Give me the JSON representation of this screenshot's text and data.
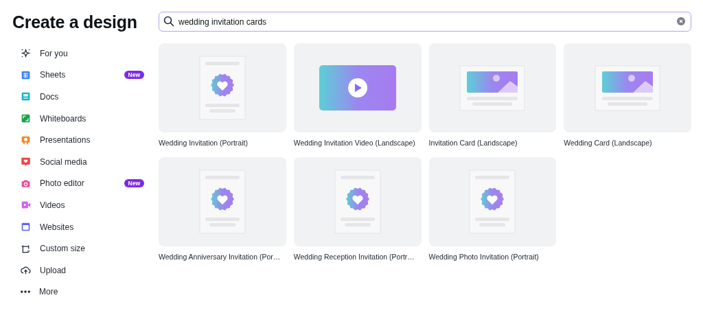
{
  "title": "Create a design",
  "sidebar": {
    "items": [
      {
        "label": "For you",
        "kind": "sparkle",
        "color": "#1f2937"
      },
      {
        "label": "Sheets",
        "kind": "sheet",
        "color": "#3b82f6",
        "badge": "New"
      },
      {
        "label": "Docs",
        "kind": "doc",
        "color": "#13b5c9"
      },
      {
        "label": "Whiteboards",
        "kind": "board",
        "color": "#16a34a"
      },
      {
        "label": "Presentations",
        "kind": "present",
        "color": "#f7861d"
      },
      {
        "label": "Social media",
        "kind": "social",
        "color": "#ef4444"
      },
      {
        "label": "Photo editor",
        "kind": "camera",
        "color": "#ec4899",
        "badge": "New"
      },
      {
        "label": "Videos",
        "kind": "video",
        "color": "#d662ef"
      },
      {
        "label": "Websites",
        "kind": "web",
        "color": "#5b6cf0"
      },
      {
        "label": "Custom size",
        "kind": "custom",
        "color": "#1f2937"
      },
      {
        "label": "Upload",
        "kind": "upload",
        "color": "#1f2937"
      },
      {
        "label": "More",
        "kind": "more",
        "color": "#1f2937"
      }
    ]
  },
  "search": {
    "value": "wedding invitation cards"
  },
  "results": [
    {
      "label": "Wedding Invitation (Portrait)",
      "kind": "portrait"
    },
    {
      "label": "Wedding Invitation Video (Landscape)",
      "kind": "video"
    },
    {
      "label": "Invitation Card (Landscape)",
      "kind": "landscape"
    },
    {
      "label": "Wedding Card (Landscape)",
      "kind": "landscape"
    },
    {
      "label": "Wedding Anniversary Invitation (Por…",
      "kind": "portrait"
    },
    {
      "label": "Wedding Reception Invitation (Portr…",
      "kind": "portrait"
    },
    {
      "label": "Wedding Photo Invitation (Portrait)",
      "kind": "portrait"
    }
  ]
}
